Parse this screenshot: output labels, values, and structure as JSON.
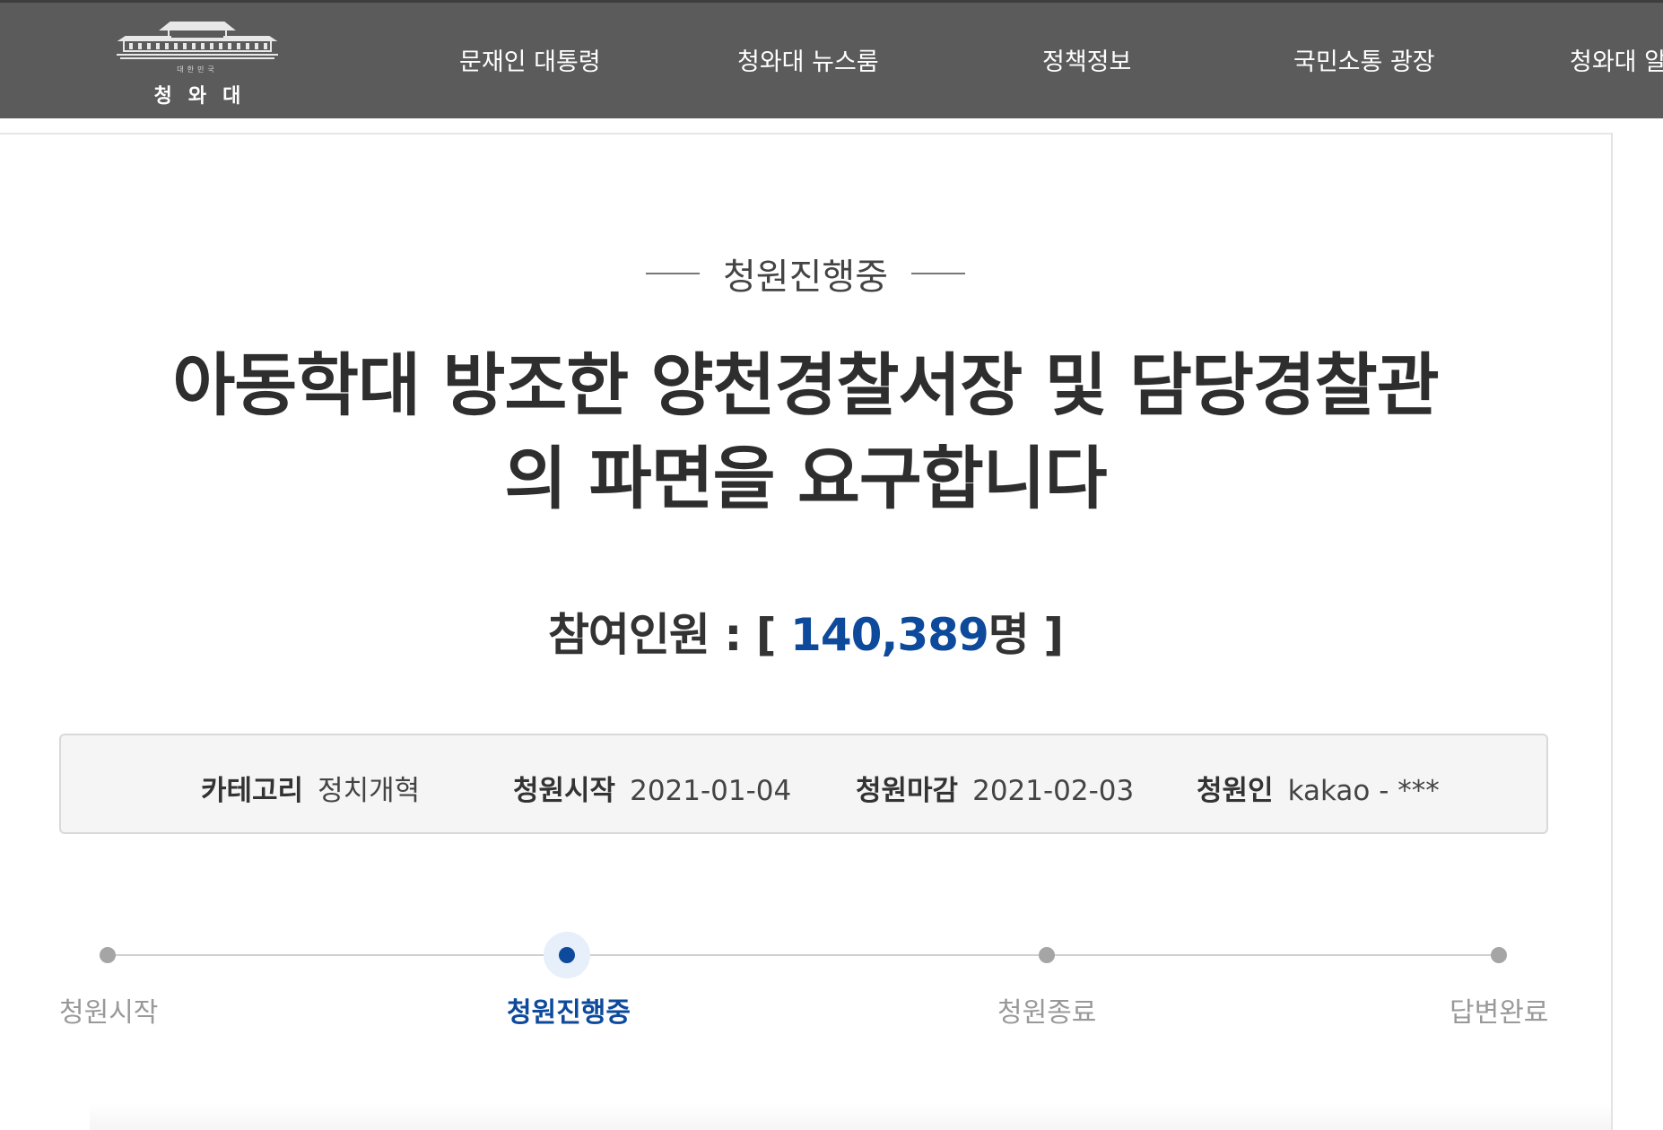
{
  "header": {
    "logo_small": "대한민국",
    "logo_text": "청와대",
    "nav": [
      "문재인 대통령",
      "청와대 뉴스룸",
      "정책정보",
      "국민소통 광장",
      "청와대 알"
    ]
  },
  "petition": {
    "status": "청원진행중",
    "title_line1": "아동학대 방조한 양천경찰서장 및 담당경찰관",
    "title_line2": "의 파면을 요구합니다",
    "count_label": "참여인원 : [",
    "count_value": "140,389",
    "count_unit": "명",
    "count_close": "]",
    "info": {
      "category_label": "카테고리",
      "category_value": "정치개혁",
      "start_label": "청원시작",
      "start_value": "2021-01-04",
      "end_label": "청원마감",
      "end_value": "2021-02-03",
      "author_label": "청원인",
      "author_value": "kakao - ***"
    },
    "steps": [
      "청원시작",
      "청원진행중",
      "청원종료",
      "답변완료"
    ],
    "active_step": 1
  },
  "colors": {
    "header_bg": "#5b5b5b",
    "accent_blue": "#0d4a9c",
    "info_bg": "#f5f5f5"
  }
}
